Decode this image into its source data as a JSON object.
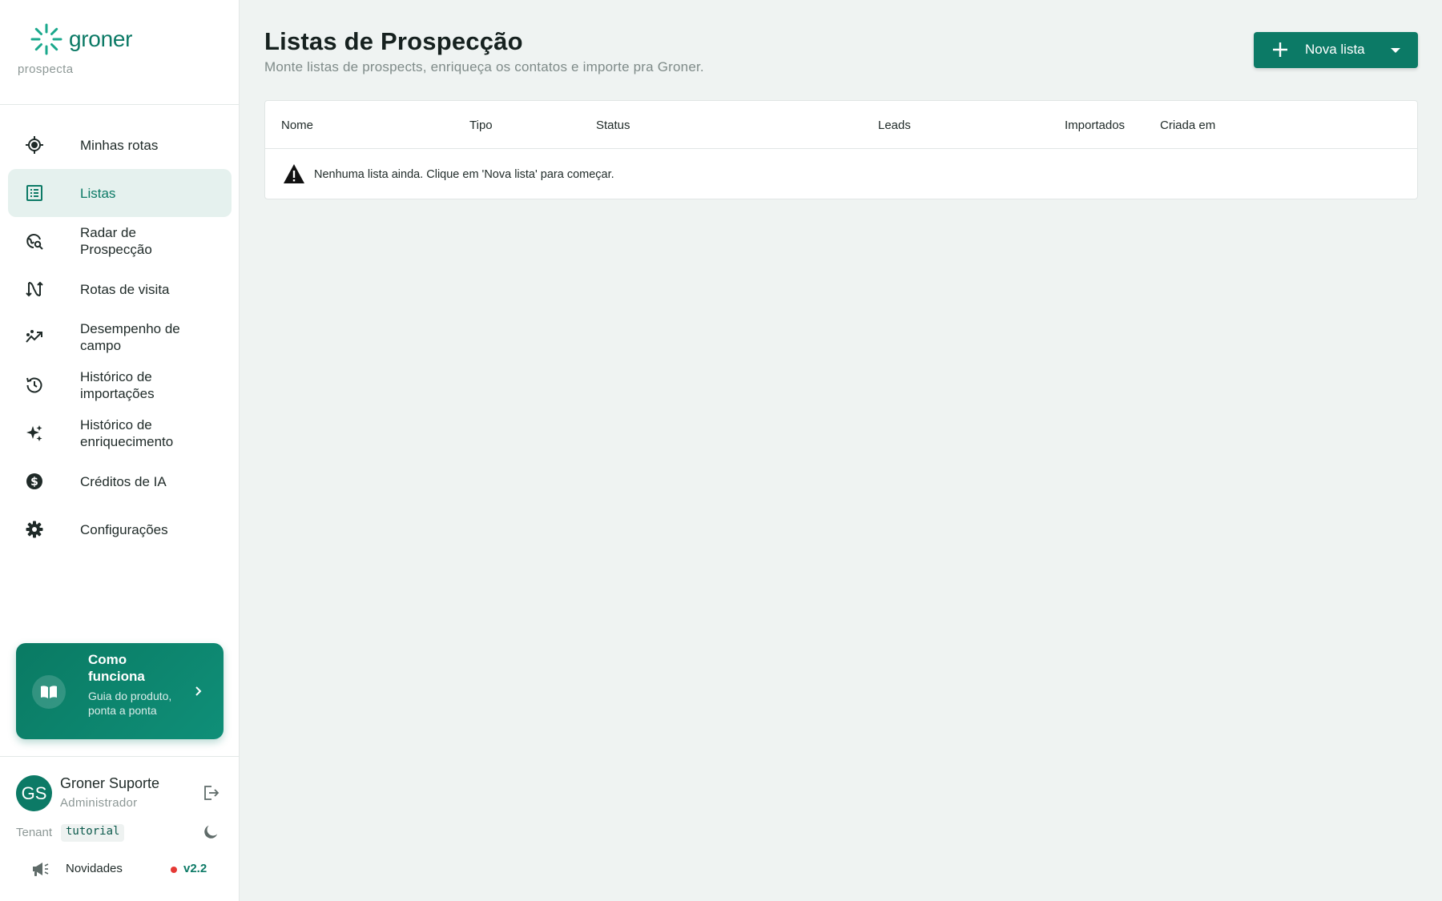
{
  "brand": {
    "name": "groner",
    "sub": "prospecta",
    "color": "#0c7a66"
  },
  "sidebar": {
    "items": [
      {
        "label": "Minhas rotas",
        "icon": "crosshair-icon",
        "active": false
      },
      {
        "label": "Listas",
        "icon": "list-icon",
        "active": true
      },
      {
        "label": "Radar de Prospecção",
        "icon": "globe-search-icon",
        "active": false
      },
      {
        "label": "Rotas de visita",
        "icon": "route-icon",
        "active": false
      },
      {
        "label": "Desempenho de campo",
        "icon": "trend-icon",
        "active": false
      },
      {
        "label": "Histórico de importações",
        "icon": "history-icon",
        "active": false
      },
      {
        "label": "Histórico de enriquecimento",
        "icon": "sparkle-icon",
        "active": false
      },
      {
        "label": "Créditos de IA",
        "icon": "dollar-icon",
        "active": false
      },
      {
        "label": "Configurações",
        "icon": "gear-icon",
        "active": false
      }
    ],
    "help": {
      "title": "Como funciona",
      "subtitle": "Guia do produto, ponta a ponta"
    },
    "user": {
      "initials": "GS",
      "name": "Groner Suporte",
      "role": "Administrador"
    },
    "tenant": {
      "label": "Tenant",
      "value": "tutorial"
    },
    "news": {
      "label": "Novidades",
      "version": "v2.2"
    }
  },
  "main": {
    "title": "Listas de Prospecção",
    "subtitle": "Monte listas de prospects, enriqueça os contatos e importe pra Groner.",
    "new_button": "Nova lista",
    "columns": [
      "Nome",
      "Tipo",
      "Status",
      "Leads",
      "Importados",
      "Criada em"
    ],
    "empty_message": "Nenhuma lista ainda. Clique em 'Nova lista' para começar."
  }
}
